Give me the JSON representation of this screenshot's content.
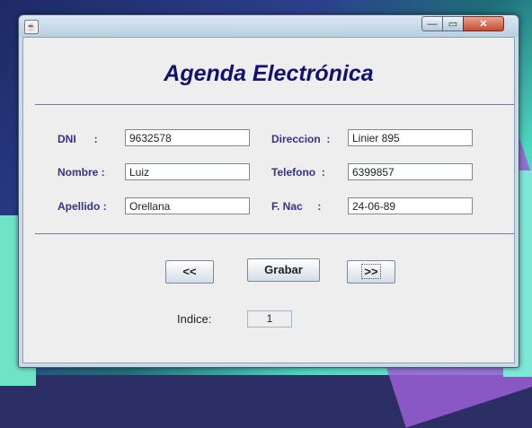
{
  "window": {
    "title": "",
    "app_icon": "java-icon",
    "controls": {
      "minimize": "—",
      "maximize": "▭",
      "close": "✕"
    }
  },
  "form": {
    "heading": "Agenda Electrónica",
    "labels": {
      "dni": "DNI      :",
      "nombre": "Nombre :",
      "apellido": "Apellido :",
      "direccion": "Direccion  :",
      "telefono": "Telefono  :",
      "fnac": "F. Nac     :"
    },
    "values": {
      "dni": "9632578",
      "nombre": "Luiz",
      "apellido": "Orellana",
      "direccion": "Linier 895",
      "telefono": "6399857",
      "fnac": "24-06-89"
    }
  },
  "buttons": {
    "prev": "<<",
    "save": "Grabar",
    "next": ">>"
  },
  "index": {
    "label": "Indice:",
    "value": "1"
  },
  "colors": {
    "heading": "#12126e",
    "labels": "#33338a",
    "panel": "#eeeeee"
  }
}
